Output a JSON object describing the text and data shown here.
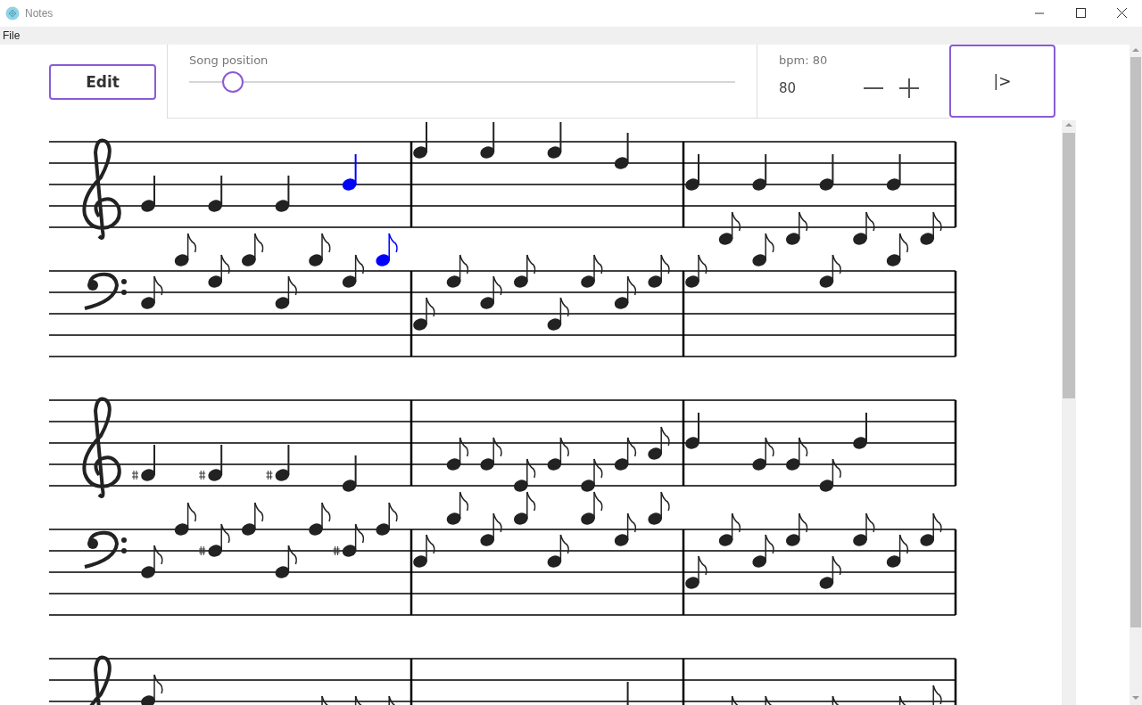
{
  "window": {
    "title": "Notes"
  },
  "menu": [
    {
      "label": "File"
    }
  ],
  "toolbar": {
    "edit_button": "Edit",
    "song_position": {
      "label": "Song position",
      "level": 0.08
    },
    "bpm": {
      "label": "bpm: 80",
      "value": "80"
    },
    "play_button": "|>"
  },
  "score": {
    "systems": [
      {
        "measures": [
          {
            "treble": [
              {
                "kind": "quarter",
                "sharp": false,
                "selected": false
              },
              {
                "kind": "quarter",
                "sharp": false,
                "selected": false
              },
              {
                "kind": "quarter",
                "sharp": false,
                "selected": false
              },
              {
                "kind": "quarter",
                "sharp": false,
                "selected": true
              }
            ],
            "bass": [
              {
                "kind": "eighth",
                "sharp": false,
                "selected": false
              },
              {
                "kind": "eighth",
                "sharp": false,
                "selected": false
              },
              {
                "kind": "eighth",
                "sharp": false,
                "selected": false
              },
              {
                "kind": "eighth",
                "sharp": false,
                "selected": false
              },
              {
                "kind": "eighth",
                "sharp": false,
                "selected": false
              },
              {
                "kind": "eighth",
                "sharp": false,
                "selected": false
              },
              {
                "kind": "eighth",
                "sharp": false,
                "selected": false
              },
              {
                "kind": "eighth",
                "sharp": false,
                "selected": true
              }
            ]
          },
          {
            "treble": [
              {
                "kind": "quarter",
                "sharp": false,
                "selected": false
              },
              {
                "kind": "quarter",
                "sharp": false,
                "selected": false
              },
              {
                "kind": "quarter",
                "sharp": false,
                "selected": false
              },
              {
                "kind": "quarter",
                "sharp": false,
                "selected": false
              }
            ],
            "bass": [
              {
                "kind": "eighth",
                "sharp": false,
                "selected": false
              },
              {
                "kind": "eighth",
                "sharp": false,
                "selected": false
              },
              {
                "kind": "eighth",
                "sharp": false,
                "selected": false
              },
              {
                "kind": "eighth",
                "sharp": false,
                "selected": false
              },
              {
                "kind": "eighth",
                "sharp": false,
                "selected": false
              },
              {
                "kind": "eighth",
                "sharp": false,
                "selected": false
              },
              {
                "kind": "eighth",
                "sharp": false,
                "selected": false
              },
              {
                "kind": "eighth",
                "sharp": false,
                "selected": false
              }
            ]
          },
          {
            "treble": [
              {
                "kind": "quarter",
                "sharp": false,
                "selected": false
              },
              {
                "kind": "quarter",
                "sharp": false,
                "selected": false
              },
              {
                "kind": "quarter",
                "sharp": false,
                "selected": false
              },
              {
                "kind": "quarter",
                "sharp": false,
                "selected": false
              }
            ],
            "bass": [
              {
                "kind": "eighth",
                "sharp": false,
                "selected": false
              },
              {
                "kind": "eighth",
                "sharp": false,
                "selected": false
              },
              {
                "kind": "eighth",
                "sharp": false,
                "selected": false
              },
              {
                "kind": "eighth",
                "sharp": false,
                "selected": false
              },
              {
                "kind": "eighth",
                "sharp": false,
                "selected": false
              },
              {
                "kind": "eighth",
                "sharp": false,
                "selected": false
              },
              {
                "kind": "eighth",
                "sharp": false,
                "selected": false
              },
              {
                "kind": "eighth",
                "sharp": false,
                "selected": false
              }
            ]
          }
        ]
      },
      {
        "measures": [
          {
            "treble": [
              {
                "kind": "quarter",
                "sharp": true,
                "selected": false
              },
              {
                "kind": "quarter",
                "sharp": true,
                "selected": false
              },
              {
                "kind": "quarter",
                "sharp": true,
                "selected": false
              },
              {
                "kind": "quarter",
                "sharp": false,
                "selected": false
              }
            ],
            "bass": [
              {
                "kind": "eighth",
                "sharp": false,
                "selected": false
              },
              {
                "kind": "eighth",
                "sharp": false,
                "selected": false
              },
              {
                "kind": "eighth",
                "sharp": true,
                "selected": false
              },
              {
                "kind": "eighth",
                "sharp": false,
                "selected": false
              },
              {
                "kind": "eighth",
                "sharp": false,
                "selected": false
              },
              {
                "kind": "eighth",
                "sharp": false,
                "selected": false
              },
              {
                "kind": "eighth",
                "sharp": true,
                "selected": false
              },
              {
                "kind": "eighth",
                "sharp": false,
                "selected": false
              }
            ]
          },
          {
            "treble": [
              {
                "kind": "eighth",
                "sharp": false,
                "selected": false
              },
              {
                "kind": "eighth",
                "sharp": false,
                "selected": false
              },
              {
                "kind": "eighth",
                "sharp": false,
                "selected": false
              },
              {
                "kind": "eighth",
                "sharp": false,
                "selected": false
              },
              {
                "kind": "eighth",
                "sharp": false,
                "selected": false
              },
              {
                "kind": "eighth",
                "sharp": false,
                "selected": false
              },
              {
                "kind": "eighth",
                "sharp": false,
                "selected": false
              }
            ],
            "bass": [
              {
                "kind": "eighth",
                "sharp": false,
                "selected": false
              },
              {
                "kind": "eighth",
                "sharp": false,
                "selected": false
              },
              {
                "kind": "eighth",
                "sharp": false,
                "selected": false
              },
              {
                "kind": "eighth",
                "sharp": false,
                "selected": false
              },
              {
                "kind": "eighth",
                "sharp": false,
                "selected": false
              },
              {
                "kind": "eighth",
                "sharp": false,
                "selected": false
              },
              {
                "kind": "eighth",
                "sharp": false,
                "selected": false
              },
              {
                "kind": "eighth",
                "sharp": false,
                "selected": false
              }
            ]
          },
          {
            "treble": [
              {
                "kind": "quarter",
                "sharp": false,
                "selected": false
              },
              {
                "kind": "eighth",
                "sharp": false,
                "selected": false
              },
              {
                "kind": "eighth",
                "sharp": false,
                "selected": false
              },
              {
                "kind": "eighth",
                "sharp": false,
                "selected": false
              },
              {
                "kind": "quarter",
                "sharp": false,
                "selected": false
              }
            ],
            "bass": [
              {
                "kind": "eighth",
                "sharp": false,
                "selected": false
              },
              {
                "kind": "eighth",
                "sharp": false,
                "selected": false
              },
              {
                "kind": "eighth",
                "sharp": false,
                "selected": false
              },
              {
                "kind": "eighth",
                "sharp": false,
                "selected": false
              },
              {
                "kind": "eighth",
                "sharp": false,
                "selected": false
              },
              {
                "kind": "eighth",
                "sharp": false,
                "selected": false
              },
              {
                "kind": "eighth",
                "sharp": false,
                "selected": false
              },
              {
                "kind": "eighth",
                "sharp": false,
                "selected": false
              }
            ]
          }
        ]
      },
      {
        "measures": [
          {
            "treble": [
              {
                "kind": "eighth",
                "sharp": false,
                "selected": false
              },
              {
                "kind": "eighth",
                "sharp": false,
                "selected": false
              },
              {
                "kind": "eighth",
                "sharp": false,
                "selected": false
              },
              {
                "kind": "eighth",
                "sharp": false,
                "selected": false
              }
            ]
          },
          {
            "treble": [
              {
                "kind": "quarter",
                "sharp": false,
                "selected": false
              }
            ]
          },
          {
            "treble": [
              {
                "kind": "eighth",
                "sharp": false,
                "selected": false
              },
              {
                "kind": "eighth",
                "sharp": false,
                "selected": false
              },
              {
                "kind": "eighth",
                "sharp": false,
                "selected": false
              },
              {
                "kind": "eighth",
                "sharp": false,
                "selected": false
              },
              {
                "kind": "eighth",
                "sharp": false,
                "selected": false
              }
            ]
          }
        ]
      }
    ]
  }
}
